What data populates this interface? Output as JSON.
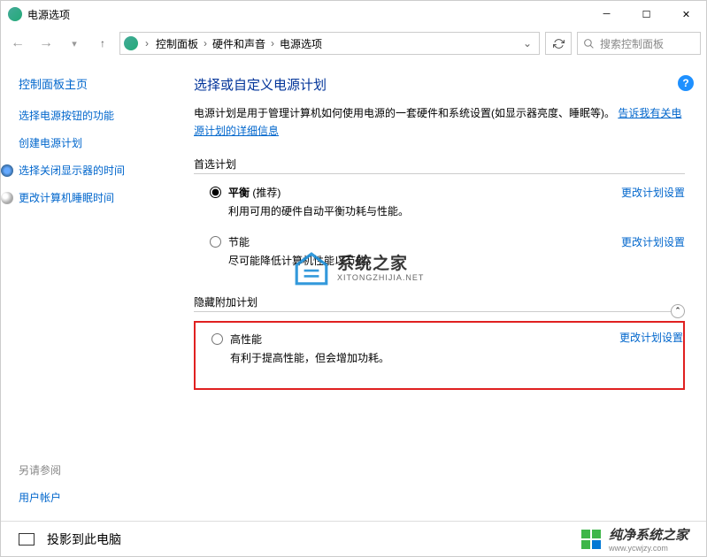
{
  "window": {
    "title": "电源选项"
  },
  "breadcrumb": {
    "items": [
      "控制面板",
      "硬件和声音",
      "电源选项"
    ]
  },
  "search": {
    "placeholder": "搜索控制面板"
  },
  "sidebar": {
    "home": "控制面板主页",
    "links": [
      "选择电源按钮的功能",
      "创建电源计划",
      "选择关闭显示器的时间",
      "更改计算机睡眠时间"
    ],
    "see_also": "另请参阅",
    "user_accounts": "用户帐户"
  },
  "main": {
    "heading": "选择或自定义电源计划",
    "intro_text": "电源计划是用于管理计算机如何使用电源的一套硬件和系统设置(如显示器亮度、睡眠等)。",
    "intro_link": "告诉我有关电源计划的详细信息",
    "section_preferred": "首选计划",
    "section_hidden": "隐藏附加计划",
    "change_plan": "更改计划设置",
    "plans": {
      "balanced": {
        "name": "平衡",
        "rec": " (推荐)",
        "desc": "利用可用的硬件自动平衡功耗与性能。"
      },
      "saver": {
        "name": "节能",
        "desc": "尽可能降低计算机性能以节能。"
      },
      "high": {
        "name": "高性能",
        "desc": "有利于提高性能，但会增加功耗。"
      }
    }
  },
  "watermark": {
    "main": "系统之家",
    "sub": "XITONGZHIJIA.NET"
  },
  "taskbar": {
    "project": "投影到此电脑",
    "brand": "纯净系统之家",
    "brand_sub": "www.ycwjzy.com"
  }
}
